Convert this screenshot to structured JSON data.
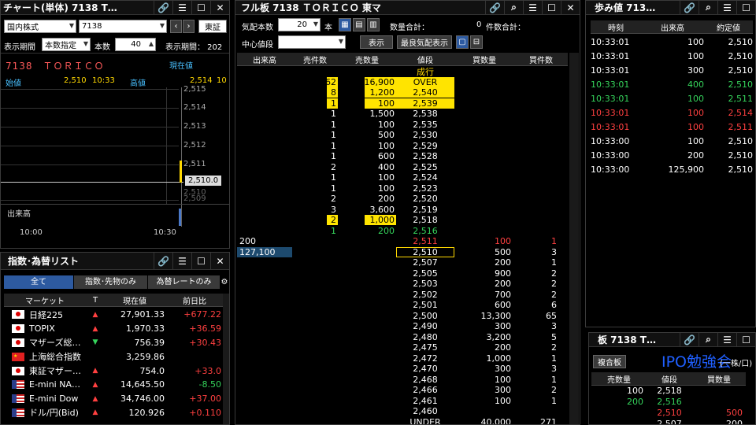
{
  "chart": {
    "title": "チャート(単体) 7138 T…",
    "market": "国内株式",
    "code": "7138",
    "exchange": "東証",
    "period_label": "表示期間",
    "period_mode": "本数指定",
    "count_label": "本数",
    "count": "40",
    "period2": "表示期間： 202",
    "name": "7138　ＴＯＲＩＣＯ",
    "current_label": "現在値",
    "open_label": "始値",
    "open": "2,510",
    "open_time": "10:33",
    "high_label": "高値",
    "high": "2,514",
    "high_time": "10",
    "volume_label": "出来高",
    "t1": "10:00",
    "t2": "10:30",
    "last_tag": "2,510.0",
    "yticks": [
      "2,515",
      "2,514",
      "2,513",
      "2,512",
      "2,511"
    ],
    "axis_partial": "2,510",
    "axis_partial2": "2,509"
  },
  "index": {
    "title": "指数･為替リスト",
    "tabs": [
      "全て",
      "指数･先物のみ",
      "為替レートのみ"
    ],
    "cols": [
      "マーケット",
      "T",
      "現在値",
      "前日比"
    ],
    "rows": [
      {
        "flag": "jp",
        "name": "日経225",
        "arrow": "▲",
        "ac": "r",
        "value": "27,901.33",
        "chg": "+677.22",
        "cc": "r"
      },
      {
        "flag": "jp",
        "name": "TOPIX",
        "arrow": "▲",
        "ac": "r",
        "value": "1,970.33",
        "chg": "+36.59",
        "cc": "r"
      },
      {
        "flag": "jp",
        "name": "マザーズ総…",
        "arrow": "▼",
        "ac": "g",
        "value": "756.39",
        "chg": "+30.43",
        "cc": "r"
      },
      {
        "flag": "cn",
        "name": "上海総合指数",
        "arrow": "",
        "ac": "w",
        "value": "3,259.86",
        "chg": "",
        "cc": "w"
      },
      {
        "flag": "jp",
        "name": "東証マザー…",
        "arrow": "▲",
        "ac": "r",
        "value": "754.0",
        "chg": "+33.0",
        "cc": "r"
      },
      {
        "flag": "us",
        "name": "E-mini NA…",
        "arrow": "▲",
        "ac": "r",
        "value": "14,645.50",
        "chg": "-8.50",
        "cc": "g"
      },
      {
        "flag": "us",
        "name": "E-mini Dow",
        "arrow": "▲",
        "ac": "r",
        "value": "34,746.00",
        "chg": "+37.00",
        "cc": "r"
      },
      {
        "flag": "usjp",
        "name": "ドル/円(Bid)",
        "arrow": "▲",
        "ac": "r",
        "value": "120.926",
        "chg": "+0.110",
        "cc": "r"
      }
    ]
  },
  "board": {
    "title": "フル板 7138 ＴＯＲＩＣＯ 東マ",
    "depth_label": "気配本数",
    "depth": "20",
    "depth_unit": "本",
    "qty_total_label": "数量合計：",
    "qty_total": "0",
    "count_total_label": "件数合計：",
    "center_label": "中心値段",
    "show_btn": "表示",
    "best_btn": "最良気配表示",
    "cols": [
      "出来高",
      "売件数",
      "売数量",
      "値段",
      "買数量",
      "買件数"
    ],
    "rows": [
      {
        "vol": "",
        "sc": "",
        "sq": "",
        "price": "成行",
        "pc": "y",
        "bq": "",
        "bc": ""
      },
      {
        "vol": "",
        "sc": "62",
        "sq": "16,900",
        "price": "OVER",
        "pc": "y",
        "bq": "",
        "bc": "",
        "hl": "1"
      },
      {
        "vol": "",
        "sc": "8",
        "sq": "1,200",
        "price": "2,540",
        "pc": "y",
        "bq": "",
        "bc": "",
        "hl": "1"
      },
      {
        "vol": "",
        "sc": "1",
        "sq": "100",
        "price": "2,539",
        "pc": "y",
        "bq": "",
        "bc": "",
        "hl": "1"
      },
      {
        "vol": "",
        "sc": "1",
        "sq": "1,500",
        "price": "2,538",
        "pc": "w",
        "bq": "",
        "bc": ""
      },
      {
        "vol": "",
        "sc": "1",
        "sq": "100",
        "price": "2,535",
        "pc": "w",
        "bq": "",
        "bc": ""
      },
      {
        "vol": "",
        "sc": "1",
        "sq": "500",
        "price": "2,530",
        "pc": "w",
        "bq": "",
        "bc": ""
      },
      {
        "vol": "",
        "sc": "1",
        "sq": "100",
        "price": "2,529",
        "pc": "w",
        "bq": "",
        "bc": ""
      },
      {
        "vol": "",
        "sc": "1",
        "sq": "600",
        "price": "2,528",
        "pc": "w",
        "bq": "",
        "bc": ""
      },
      {
        "vol": "",
        "sc": "2",
        "sq": "400",
        "price": "2,525",
        "pc": "w",
        "bq": "",
        "bc": ""
      },
      {
        "vol": "",
        "sc": "1",
        "sq": "100",
        "price": "2,524",
        "pc": "w",
        "bq": "",
        "bc": ""
      },
      {
        "vol": "",
        "sc": "1",
        "sq": "100",
        "price": "2,523",
        "pc": "w",
        "bq": "",
        "bc": ""
      },
      {
        "vol": "",
        "sc": "2",
        "sq": "200",
        "price": "2,520",
        "pc": "w",
        "bq": "",
        "bc": ""
      },
      {
        "vol": "",
        "sc": "3",
        "sq": "3,600",
        "price": "2,519",
        "pc": "w",
        "bq": "",
        "bc": ""
      },
      {
        "vol": "",
        "sc": "2",
        "sq": "1,000",
        "price": "2,518",
        "pc": "w",
        "bq": "",
        "bc": "",
        "hl": "1"
      },
      {
        "vol": "",
        "sc": "1",
        "sq": "200",
        "price": "2,516",
        "pc": "g",
        "bq": "",
        "bc": "",
        "green": "1"
      },
      {
        "vol": "200",
        "sc": "",
        "sq": "",
        "price": "2,511",
        "pc": "r",
        "bq": "100",
        "bc": "1",
        "red": "1"
      },
      {
        "vol": "127,100",
        "sc": "",
        "sq": "",
        "price": "2,510",
        "pc": "w",
        "bq": "500",
        "bc": "3",
        "cur": "1"
      },
      {
        "vol": "",
        "sc": "",
        "sq": "",
        "price": "2,507",
        "pc": "w",
        "bq": "200",
        "bc": "1"
      },
      {
        "vol": "",
        "sc": "",
        "sq": "",
        "price": "2,505",
        "pc": "w",
        "bq": "900",
        "bc": "2"
      },
      {
        "vol": "",
        "sc": "",
        "sq": "",
        "price": "2,503",
        "pc": "w",
        "bq": "200",
        "bc": "2"
      },
      {
        "vol": "",
        "sc": "",
        "sq": "",
        "price": "2,502",
        "pc": "w",
        "bq": "700",
        "bc": "2"
      },
      {
        "vol": "",
        "sc": "",
        "sq": "",
        "price": "2,501",
        "pc": "w",
        "bq": "600",
        "bc": "6"
      },
      {
        "vol": "",
        "sc": "",
        "sq": "",
        "price": "2,500",
        "pc": "w",
        "bq": "13,300",
        "bc": "65"
      },
      {
        "vol": "",
        "sc": "",
        "sq": "",
        "price": "2,490",
        "pc": "w",
        "bq": "300",
        "bc": "3"
      },
      {
        "vol": "",
        "sc": "",
        "sq": "",
        "price": "2,480",
        "pc": "w",
        "bq": "3,200",
        "bc": "5"
      },
      {
        "vol": "",
        "sc": "",
        "sq": "",
        "price": "2,475",
        "pc": "w",
        "bq": "200",
        "bc": "2"
      },
      {
        "vol": "",
        "sc": "",
        "sq": "",
        "price": "2,472",
        "pc": "w",
        "bq": "1,000",
        "bc": "1"
      },
      {
        "vol": "",
        "sc": "",
        "sq": "",
        "price": "2,470",
        "pc": "w",
        "bq": "300",
        "bc": "3"
      },
      {
        "vol": "",
        "sc": "",
        "sq": "",
        "price": "2,468",
        "pc": "w",
        "bq": "100",
        "bc": "1"
      },
      {
        "vol": "",
        "sc": "",
        "sq": "",
        "price": "2,466",
        "pc": "w",
        "bq": "300",
        "bc": "2"
      },
      {
        "vol": "",
        "sc": "",
        "sq": "",
        "price": "2,461",
        "pc": "w",
        "bq": "100",
        "bc": "1"
      },
      {
        "vol": "",
        "sc": "",
        "sq": "",
        "price": "2,460",
        "pc": "w",
        "bq": "",
        "bc": ""
      },
      {
        "vol": "",
        "sc": "",
        "sq": "",
        "price": "UNDER",
        "pc": "w",
        "bq": "40,000",
        "bc": "271"
      }
    ]
  },
  "ticks": {
    "title": "歩み値 713…",
    "cols": [
      "時刻",
      "出来高",
      "約定値"
    ],
    "rows": [
      {
        "time": "10:33:01",
        "vol": "100",
        "price": "2,510",
        "c": "w"
      },
      {
        "time": "10:33:01",
        "vol": "100",
        "price": "2,510",
        "c": "w"
      },
      {
        "time": "10:33:01",
        "vol": "300",
        "price": "2,510",
        "c": "w"
      },
      {
        "time": "10:33:01",
        "vol": "400",
        "price": "2,510",
        "c": "g"
      },
      {
        "time": "10:33:01",
        "vol": "100",
        "price": "2,511",
        "c": "g"
      },
      {
        "time": "10:33:01",
        "vol": "100",
        "price": "2,514",
        "c": "r"
      },
      {
        "time": "10:33:01",
        "vol": "100",
        "price": "2,511",
        "c": "r"
      },
      {
        "time": "10:33:00",
        "vol": "100",
        "price": "2,510",
        "c": "w"
      },
      {
        "time": "10:33:00",
        "vol": "200",
        "price": "2,510",
        "c": "w"
      },
      {
        "time": "10:33:00",
        "vol": "125,900",
        "price": "2,510",
        "c": "w"
      }
    ]
  },
  "mini": {
    "title": "板 7138 T…",
    "combo": "複合板",
    "overlay": "IPO勉強会",
    "unit": "(一株/口)",
    "cols": [
      "売数量",
      "値段",
      "買数量"
    ],
    "rows": [
      {
        "sq": "100",
        "price": "2,518",
        "bq": "",
        "pc": "w"
      },
      {
        "sq": "200",
        "price": "2,516",
        "bq": "",
        "pc": "g",
        "sqc": "g"
      },
      {
        "sq": "",
        "price": "2,510",
        "bq": "500",
        "pc": "r"
      },
      {
        "sq": "",
        "price": "2,507",
        "bq": "200",
        "pc": "w"
      }
    ]
  }
}
